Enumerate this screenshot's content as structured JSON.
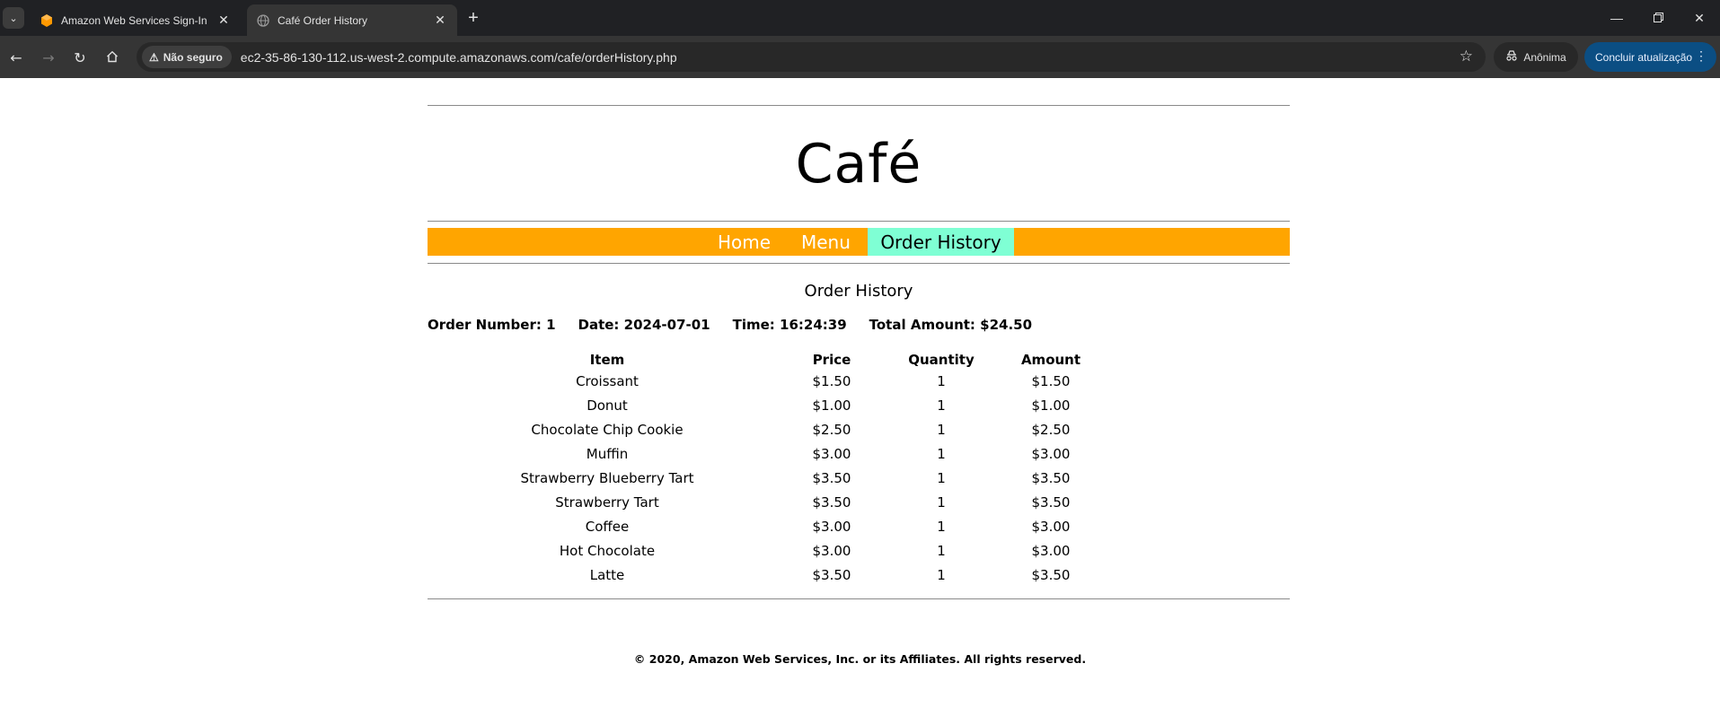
{
  "browser": {
    "tabs": [
      {
        "title": "Amazon Web Services Sign-In",
        "icon": "aws-cube-icon",
        "active": false
      },
      {
        "title": "Café Order History",
        "icon": "globe-icon",
        "active": true
      }
    ],
    "security_label": "Não seguro",
    "url": "ec2-35-86-130-112.us-west-2.compute.amazonaws.com/cafe/orderHistory.php",
    "incognito_label": "Anônima",
    "update_label": "Concluir atualização"
  },
  "site": {
    "brand": "Café",
    "nav": {
      "home": "Home",
      "menu": "Menu",
      "order_history": "Order History"
    },
    "nav_colors": {
      "bar": "#ffa500",
      "active": "#7fffd4"
    }
  },
  "page": {
    "heading": "Order History",
    "order": {
      "number_label": "Order Number: 1",
      "date_label": "Date: 2024-07-01",
      "time_label": "Time: 16:24:39",
      "total_label": "Total Amount: $24.50"
    },
    "table": {
      "headers": [
        "Item",
        "Price",
        "Quantity",
        "Amount"
      ],
      "rows": [
        [
          "Croissant",
          "$1.50",
          "1",
          "$1.50"
        ],
        [
          "Donut",
          "$1.00",
          "1",
          "$1.00"
        ],
        [
          "Chocolate Chip Cookie",
          "$2.50",
          "1",
          "$2.50"
        ],
        [
          "Muffin",
          "$3.00",
          "1",
          "$3.00"
        ],
        [
          "Strawberry Blueberry Tart",
          "$3.50",
          "1",
          "$3.50"
        ],
        [
          "Strawberry Tart",
          "$3.50",
          "1",
          "$3.50"
        ],
        [
          "Coffee",
          "$3.00",
          "1",
          "$3.00"
        ],
        [
          "Hot Chocolate",
          "$3.00",
          "1",
          "$3.00"
        ],
        [
          "Latte",
          "$3.50",
          "1",
          "$3.50"
        ]
      ]
    },
    "footer": "© 2020, Amazon Web Services, Inc. or its Affiliates. All rights reserved."
  }
}
